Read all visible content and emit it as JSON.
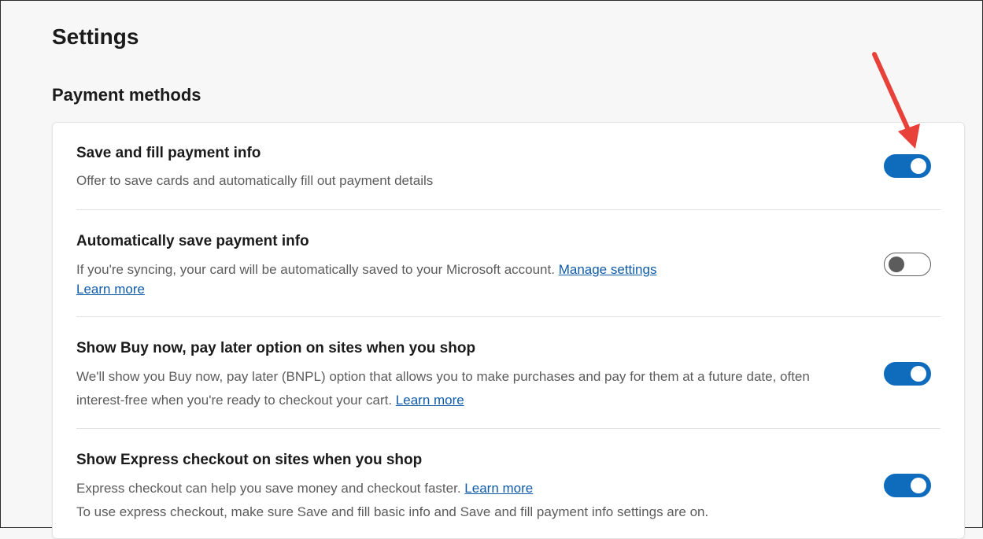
{
  "page": {
    "title": "Settings",
    "section_title": "Payment methods"
  },
  "colors": {
    "accent": "#0f6cbd",
    "link": "#0f5ba7",
    "annotation_arrow": "#e8413a"
  },
  "settings": [
    {
      "title": "Save and fill payment info",
      "description": "Offer to save cards and automatically fill out payment details",
      "toggle": "on"
    },
    {
      "title": "Automatically save payment info",
      "description": "If you're syncing, your card will be automatically saved to your Microsoft account.",
      "link_manage": "Manage settings",
      "link_learn": "Learn more",
      "toggle": "off"
    },
    {
      "title": "Show Buy now, pay later option on sites when you shop",
      "description_line1": "We'll show you Buy now, pay later (BNPL) option that allows you to make purchases and pay for them at a future date, often",
      "description_line2": "interest-free when you're ready to checkout your cart.",
      "link_learn": "Learn more",
      "toggle": "on"
    },
    {
      "title": "Show Express checkout on sites when you shop",
      "description_line1": "Express checkout can help you save money and checkout faster.",
      "link_learn": "Learn more",
      "description_line2": "To use express checkout, make sure Save and fill basic info and Save and fill payment info settings are on.",
      "toggle": "on"
    }
  ],
  "annotation": {
    "icon": "red-arrow-icon",
    "points_to": "save-and-fill-payment-info-toggle"
  }
}
